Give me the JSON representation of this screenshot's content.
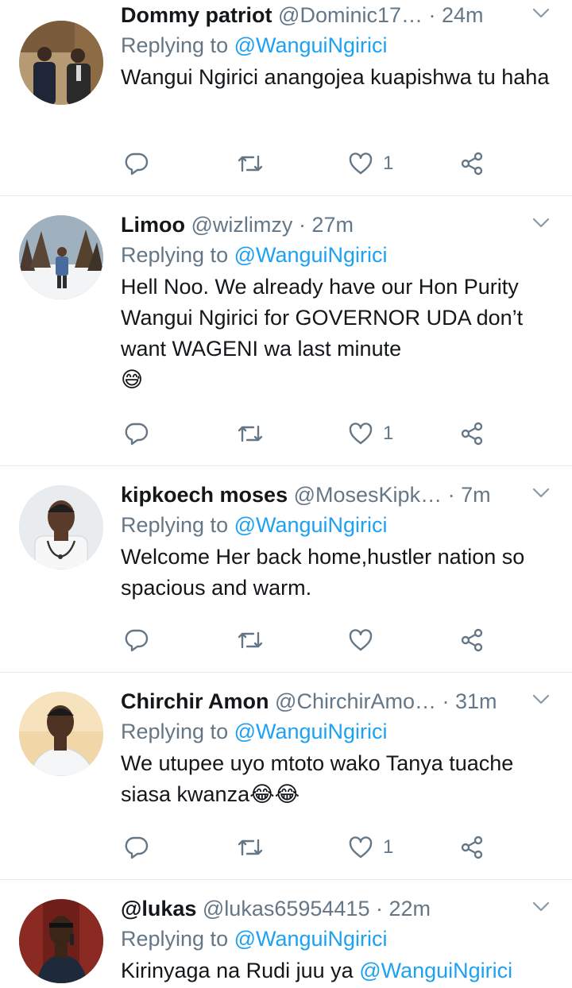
{
  "colors": {
    "link": "#1da1f2",
    "muted": "#657786",
    "text": "#14171a",
    "divider": "#e6ecf0"
  },
  "icons": {
    "reply": "reply-icon",
    "retweet": "retweet-icon",
    "like": "heart-icon",
    "share": "share-icon",
    "caret": "chevron-down-icon"
  },
  "tweets": [
    {
      "name": "Dommy patriot",
      "handle": "@Dominic17…",
      "time": "· 24m",
      "replying_prefix": "Replying to ",
      "replying_to": "@WanguiNgirici",
      "text": "Wangui Ngirici anangojea kuapishwa tu haha",
      "likes": "1"
    },
    {
      "name": "Limoo",
      "handle": "@wizlimzy",
      "time": "· 27m",
      "replying_prefix": "Replying to ",
      "replying_to": "@WanguiNgirici",
      "text": "Hell Noo. We already have our Hon Purity Wangui Ngirici for GOVERNOR UDA don’t want WAGENI wa last minute",
      "emoji": "😅",
      "likes": "1"
    },
    {
      "name": "kipkoech moses",
      "handle": "@MosesKipk…",
      "time": "· 7m",
      "replying_prefix": "Replying to ",
      "replying_to": "@WanguiNgirici",
      "text": "Welcome Her back home,hustler nation so spacious and warm.",
      "likes": ""
    },
    {
      "name": "Chirchir Amon",
      "handle": "@ChirchirAmo…",
      "time": "· 31m",
      "replying_prefix": "Replying to ",
      "replying_to": "@WanguiNgirici",
      "text": "We utupee uyo mtoto wako Tanya tuache siasa kwanza",
      "emoji": "😂😂",
      "likes": "1"
    },
    {
      "name": "@lukas",
      "handle": "@lukas65954415",
      "time": "· 22m",
      "replying_prefix": "Replying to ",
      "replying_to": "@WanguiNgirici",
      "text": "Kirinyaga na Rudi juu ya ",
      "text_mention": "@WanguiNgirici",
      "likes": ""
    }
  ]
}
